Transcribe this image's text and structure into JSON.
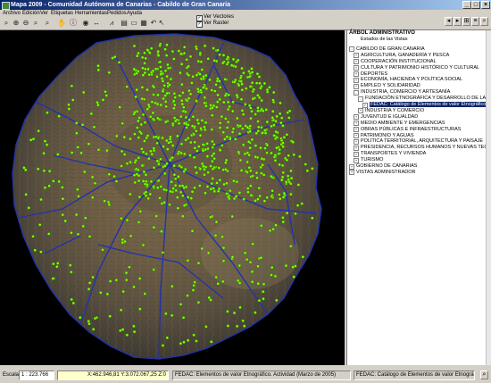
{
  "window": {
    "title": "Mapa 2009 - Comunidad Autónoma de Canarias - Cabildo de Gran Canaria",
    "buttons": {
      "minimize": "_",
      "maximize": "□",
      "close": "×"
    }
  },
  "menu": [
    "Archivo",
    "Edición",
    "Ver",
    "Etiquetas",
    "Herramientas",
    "Pedidos",
    "Ayuda"
  ],
  "toolbar": {
    "icons": [
      "zoom-extent-icon",
      "zoom-in-icon",
      "zoom-out-icon",
      "zoom-window-icon",
      "zoom-previous-icon",
      "pan-hand-icon",
      "info-icon",
      "identify-icon",
      "measure-icon",
      "profile-icon",
      "layers-icon",
      "print-icon",
      "export-icon",
      "undo-icon",
      "cursor-icon"
    ],
    "checks": [
      {
        "label": "Ver Vectores",
        "checked": true
      },
      {
        "label": "Ver Raster",
        "checked": true
      }
    ]
  },
  "panel": {
    "header": "ÁRBOL ADMINISTRATIVO",
    "items": [
      {
        "label": "Estados de las Vistas",
        "level": 1,
        "box": "",
        "selected": false
      },
      {
        "label": "CABILDO DE GRAN CANARIA",
        "level": 0,
        "box": "-",
        "selected": false
      },
      {
        "label": "AGRICULTURA, GANADERÍA Y PESCA",
        "level": 1,
        "box": "+",
        "selected": false
      },
      {
        "label": "COOPERACIÓN INSTITUCIONAL",
        "level": 1,
        "box": "+",
        "selected": false
      },
      {
        "label": "CULTURA Y PATRIMONIO HISTÓRICO Y CULTURAL",
        "level": 1,
        "box": "+",
        "selected": false
      },
      {
        "label": "DEPORTES",
        "level": 1,
        "box": "+",
        "selected": false
      },
      {
        "label": "ECONOMÍA, HACIENDA Y POLÍTICA SOCIAL",
        "level": 1,
        "box": "+",
        "selected": false
      },
      {
        "label": "EMPLEO Y SOLIDARIDAD",
        "level": 1,
        "box": "+",
        "selected": false
      },
      {
        "label": "INDUSTRIA, COMERCIO Y ARTESANÍA",
        "level": 1,
        "box": "-",
        "selected": false
      },
      {
        "label": "FUNDACIÓN ETNOGRÁFICA Y DESARROLLO DE LA ARTESAN",
        "level": 2,
        "box": "-",
        "selected": false
      },
      {
        "label": "FEDAC: Catálogo de Elementos de valor Etnográfico",
        "level": 3,
        "box": "✓",
        "selected": true
      },
      {
        "label": "INDUSTRIA Y COMERCIO",
        "level": 2,
        "box": "+",
        "selected": false
      },
      {
        "label": "JUVENTUD E IGUALDAD",
        "level": 1,
        "box": "+",
        "selected": false
      },
      {
        "label": "MEDIO AMBIENTE Y EMERGENCIAS",
        "level": 1,
        "box": "+",
        "selected": false
      },
      {
        "label": "OBRAS PÚBLICAS E INFRAESTRUCTURAS",
        "level": 1,
        "box": "+",
        "selected": false
      },
      {
        "label": "PATRIMONIO Y AGUAS",
        "level": 1,
        "box": "+",
        "selected": false
      },
      {
        "label": "POLÍTICA TERRITORIAL, ARQUITECTURA Y PAISAJE",
        "level": 1,
        "box": "+",
        "selected": false
      },
      {
        "label": "PRESIDENCIA, RECURSOS HUMANOS Y NUEVAS TECNOLOGÍAS",
        "level": 1,
        "box": "+",
        "selected": false
      },
      {
        "label": "TRANSPORTES Y VIVIENDA",
        "level": 1,
        "box": "+",
        "selected": false
      },
      {
        "label": "TURISMO",
        "level": 1,
        "box": "+",
        "selected": false
      },
      {
        "label": "GOBIERNO DE CANARIAS",
        "level": 0,
        "box": "+",
        "selected": false
      },
      {
        "label": "VISTAS ADMINISTRADOR",
        "level": 0,
        "box": "+",
        "selected": false
      }
    ]
  },
  "status": {
    "scale_label": "Escala",
    "scale_value": "1 : 223.766",
    "coords": "X:462.946,81  Y:3.072.067,25  Z:0",
    "layer_info": "FEDAC: Elementos de valor Etnográfico. Actividad (Marzo de 2005)",
    "catalog": "FEDAC: Catálogo de Elementos de valor Etnográfico"
  },
  "colors": {
    "titlebar": "#0a246a",
    "points": "#7fff00",
    "roads": "#2233aa",
    "selection": "#0a246a"
  }
}
